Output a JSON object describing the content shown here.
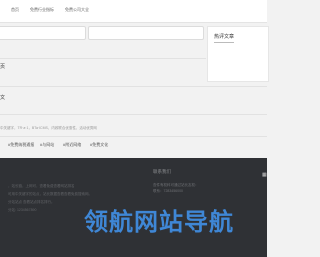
{
  "nav": {
    "items": [
      "首页",
      "免费行业指标",
      "免费公司大全"
    ]
  },
  "search": {
    "placeholder_left": "",
    "placeholder_right": ""
  },
  "side": {
    "title": "热评文章"
  },
  "sections": [
    "页",
    "文"
  ],
  "links_row": "中关键字，TR·a·1，BTa·ICMS，内政联合优惠性，活动优秀网",
  "tags": [
    "#免费纳税通报",
    "#与网站",
    "#附近网络",
    "#免费文化"
  ],
  "footer": {
    "lines": [
      "，站长链，上网可，查看免费查看网站排名",
      "可用中关键字的站点，站长数据查看查看免费搜索网。",
      "分站站点 查看站点排名排行。",
      "分站: 1234567890"
    ],
    "contact_title": "联系我们",
    "contact_lines": [
      "查件有权科可通过站长友权：",
      "联系：7283456000"
    ]
  },
  "watermark": "领航网站导航"
}
